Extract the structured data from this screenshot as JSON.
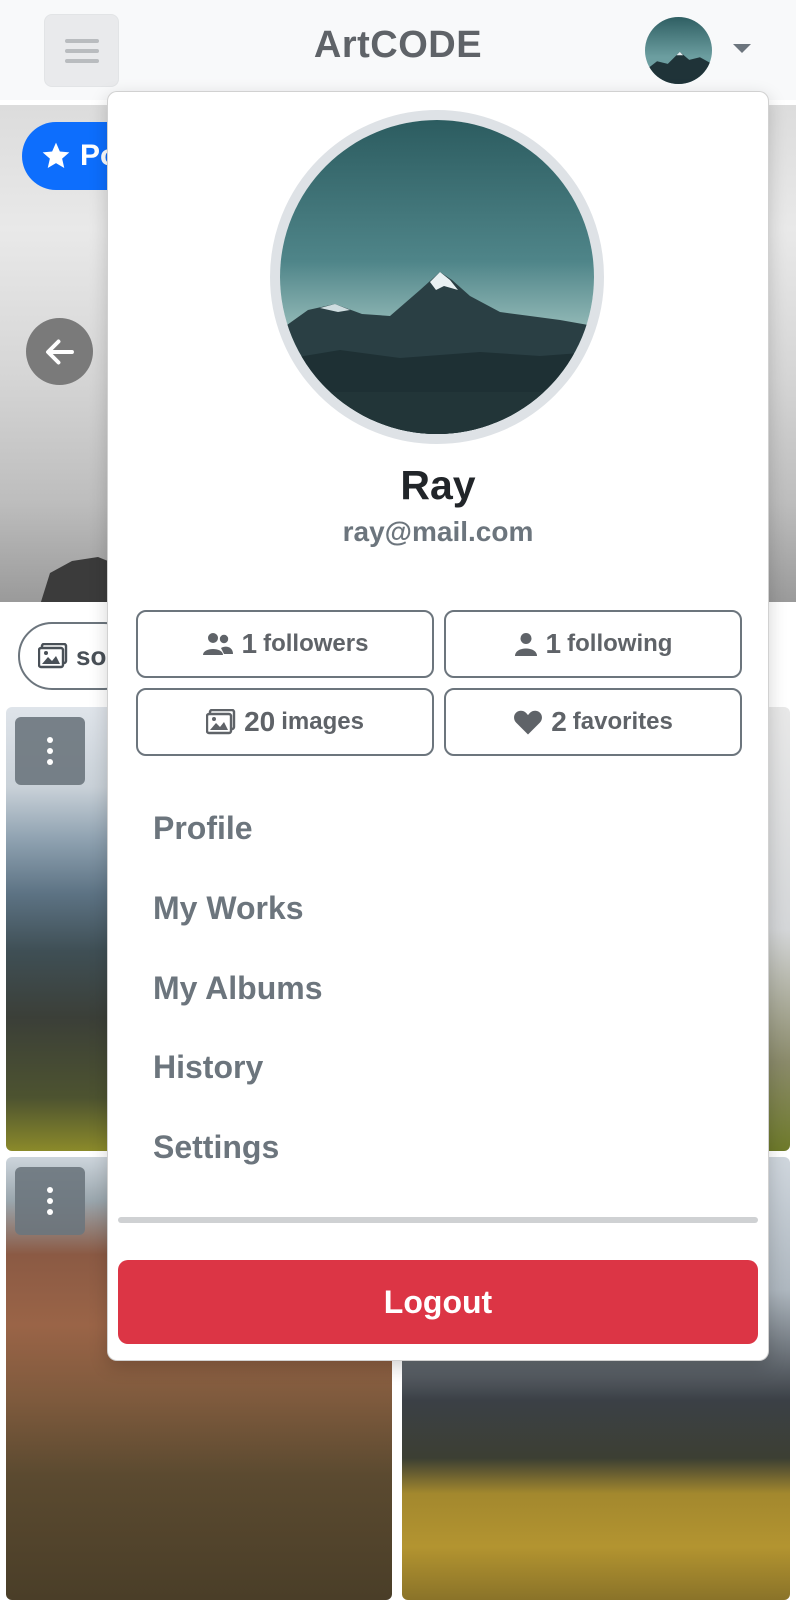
{
  "app": {
    "title": "ArtCODE"
  },
  "background": {
    "popular_label": "Po",
    "search_chip_label": "so"
  },
  "user_menu": {
    "name": "Ray",
    "email": "ray@mail.com",
    "stats": [
      {
        "icon": "users-icon",
        "count": "1",
        "unit": "followers"
      },
      {
        "icon": "user-icon",
        "count": "1",
        "unit": "following"
      },
      {
        "icon": "images-icon",
        "count": "20",
        "unit": "images"
      },
      {
        "icon": "heart-icon",
        "count": "2",
        "unit": "favorites"
      }
    ],
    "items": [
      "Profile",
      "My Works",
      "My Albums",
      "History",
      "Settings"
    ],
    "logout_label": "Logout"
  },
  "colors": {
    "primary": "#0d6efd",
    "danger": "#dc3545",
    "secondary": "#6c757d"
  }
}
